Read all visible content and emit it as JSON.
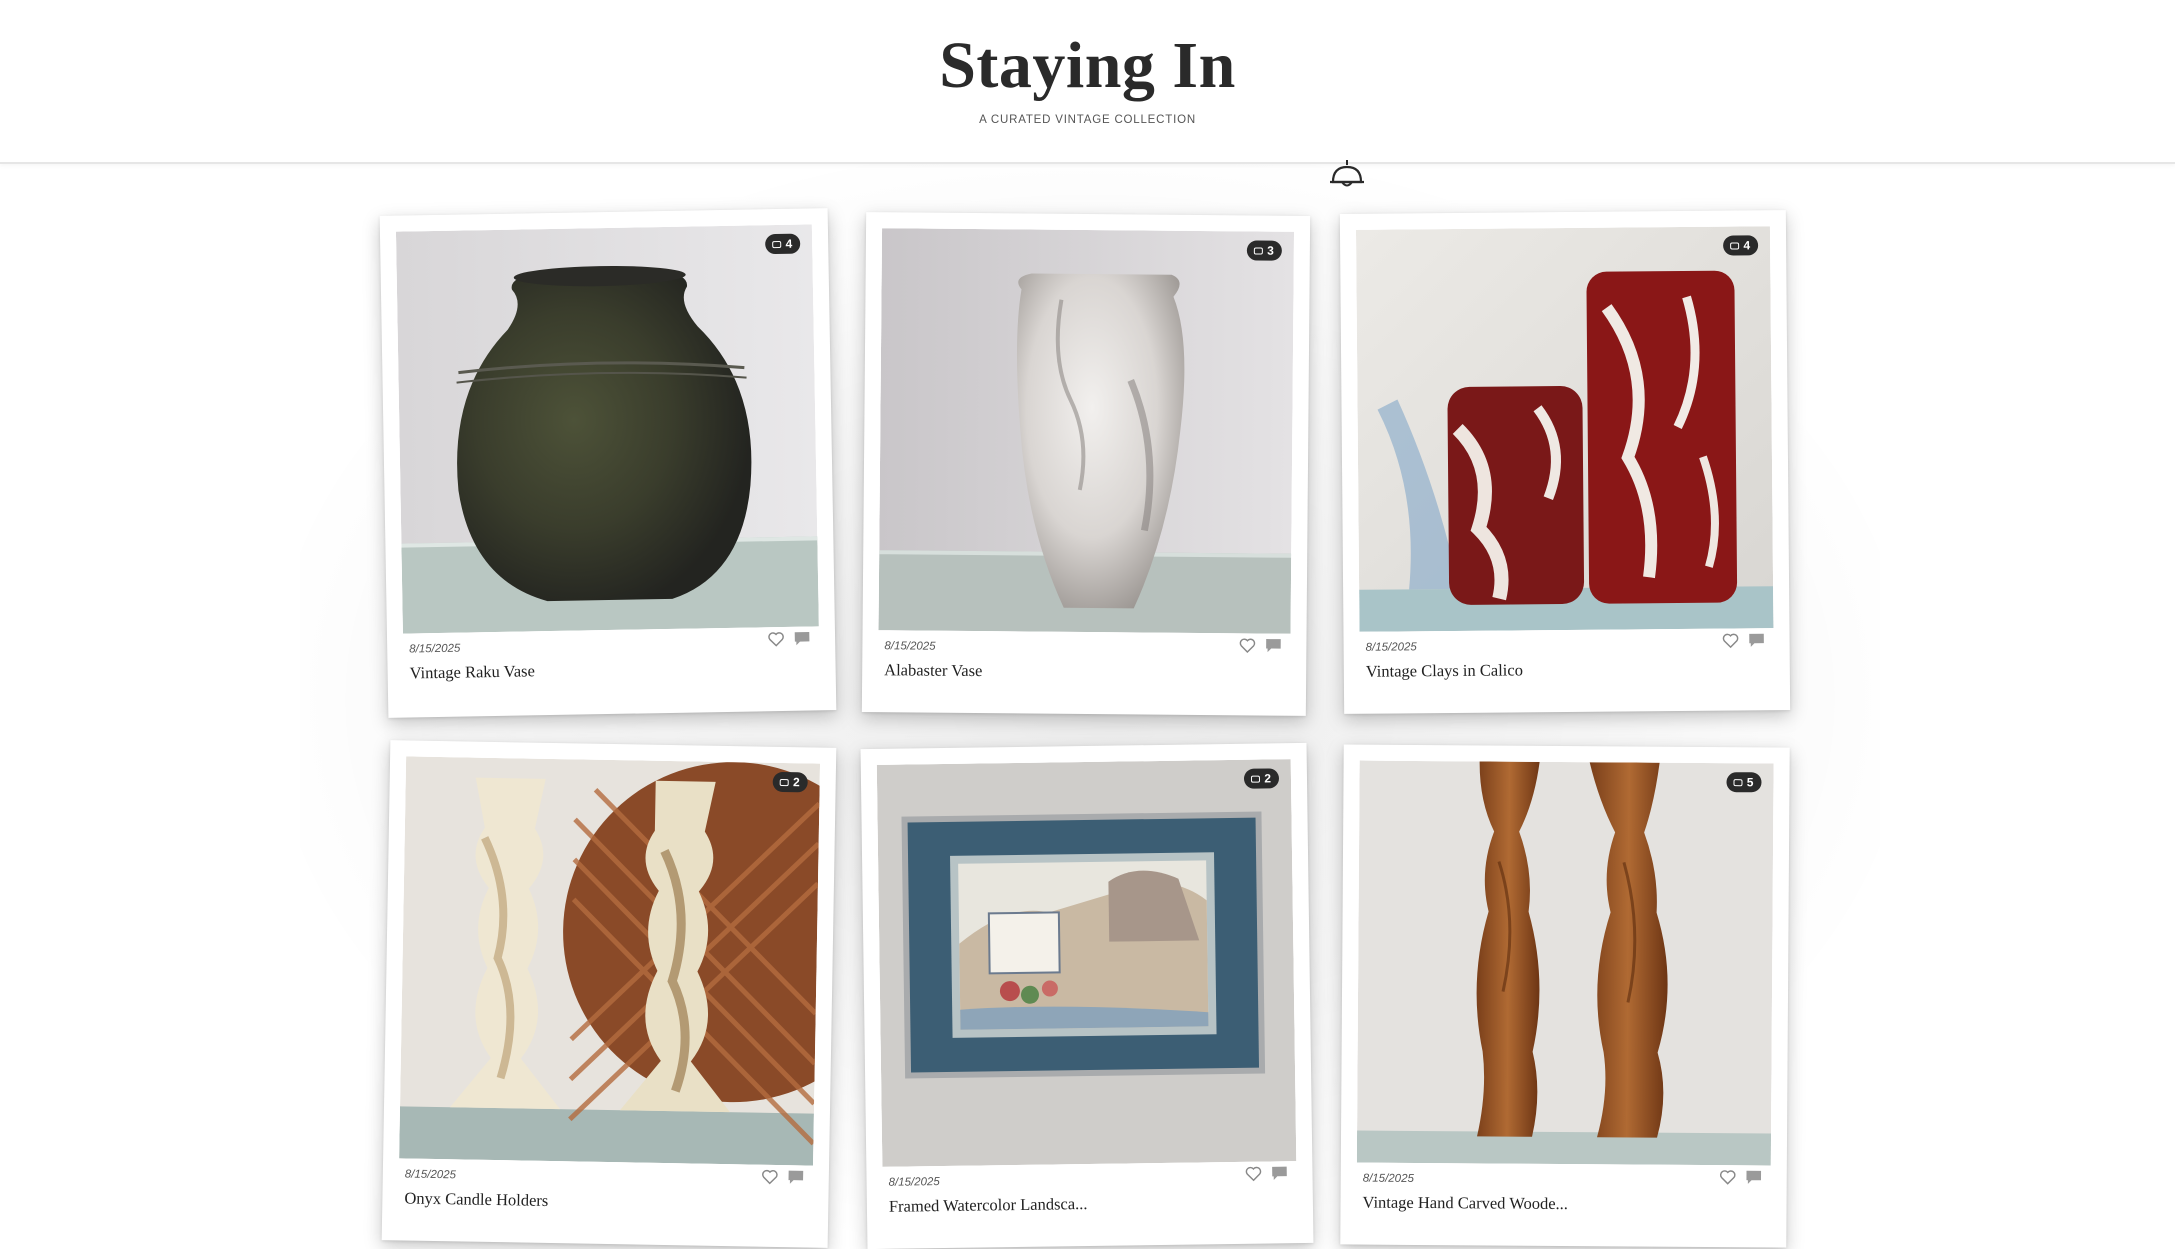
{
  "header": {
    "title": "Staying In",
    "subtitle": "A CURATED VINTAGE COLLECTION"
  },
  "icons": {
    "lamp": "ceiling-lamp-icon",
    "badge": "photo-stack-icon",
    "like": "heart-outline-icon",
    "comment": "speech-bubble-icon"
  },
  "items": [
    {
      "date": "8/15/2025",
      "title": "Vintage Raku Vase",
      "photo_count": "4"
    },
    {
      "date": "8/15/2025",
      "title": "Alabaster Vase",
      "photo_count": "3"
    },
    {
      "date": "8/15/2025",
      "title": "Vintage Clays in Calico",
      "photo_count": "4"
    },
    {
      "date": "8/15/2025",
      "title": "Onyx Candle Holders",
      "photo_count": "2"
    },
    {
      "date": "8/15/2025",
      "title": "Framed Watercolor Landsca...",
      "photo_count": "2"
    },
    {
      "date": "8/15/2025",
      "title": "Vintage Hand Carved Woode...",
      "photo_count": "5"
    }
  ]
}
